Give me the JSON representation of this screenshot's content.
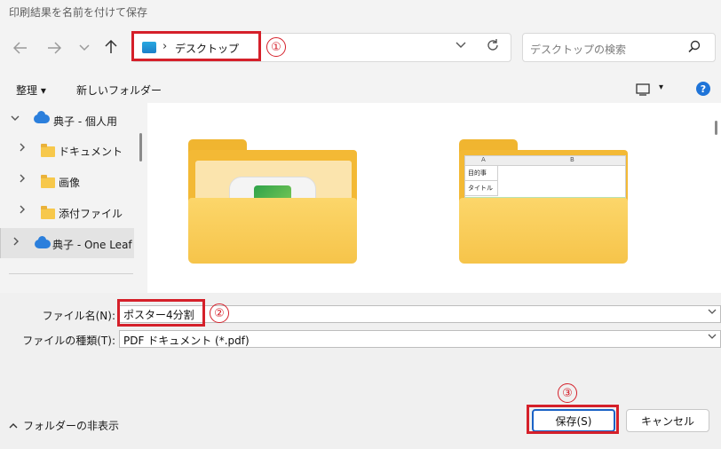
{
  "window": {
    "title": "印刷結果を名前を付けて保存"
  },
  "address": {
    "path": "デスクトップ",
    "separator": "›"
  },
  "search": {
    "placeholder": "デスクトップの検索"
  },
  "toolbar": {
    "organize": "整理 ▾",
    "new_folder": "新しいフォルダー",
    "view_arrow": "▾",
    "help": "?"
  },
  "sidebar": {
    "items": [
      {
        "label": "典子 - 個人用"
      },
      {
        "label": "ドキュメント"
      },
      {
        "label": "画像"
      },
      {
        "label": "添付ファイル"
      },
      {
        "label": "典子 - One Leaf"
      }
    ]
  },
  "sheet_preview": {
    "col_a": "A",
    "col_b": "B",
    "row1": "目的事",
    "row2": "タイトル"
  },
  "form": {
    "filename_label": "ファイル名(N):",
    "filename_value": "ポスター4分割",
    "filetype_label": "ファイルの種類(T):",
    "filetype_value": "PDF ドキュメント (*.pdf)"
  },
  "footer": {
    "hide_folders": "フォルダーの非表示",
    "save": "保存(S)",
    "cancel": "キャンセル"
  },
  "annotations": {
    "n1": "①",
    "n2": "②",
    "n3": "③"
  },
  "colors": {
    "accent": "#1a62c6",
    "annotation": "#d5202a",
    "folder": "#f6c44a"
  }
}
